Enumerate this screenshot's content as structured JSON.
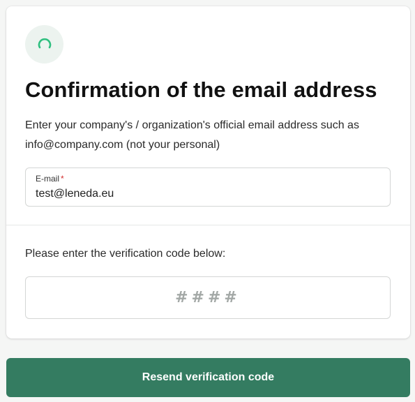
{
  "header": {
    "icon": "loading-spinner-icon",
    "title": "Confirmation of the email address",
    "description": "Enter your company's / organization's official email address such as info@company.com (not your personal)"
  },
  "email": {
    "label": "E-mail",
    "required_marker": "*",
    "value": "test@leneda.eu"
  },
  "verification": {
    "prompt": "Please enter the verification code below:",
    "placeholder": "####",
    "value": ""
  },
  "actions": {
    "resend_label": "Resend verification code"
  },
  "colors": {
    "accent": "#347c61",
    "spinner": "#2fbf7f",
    "required": "#d32f2f"
  }
}
